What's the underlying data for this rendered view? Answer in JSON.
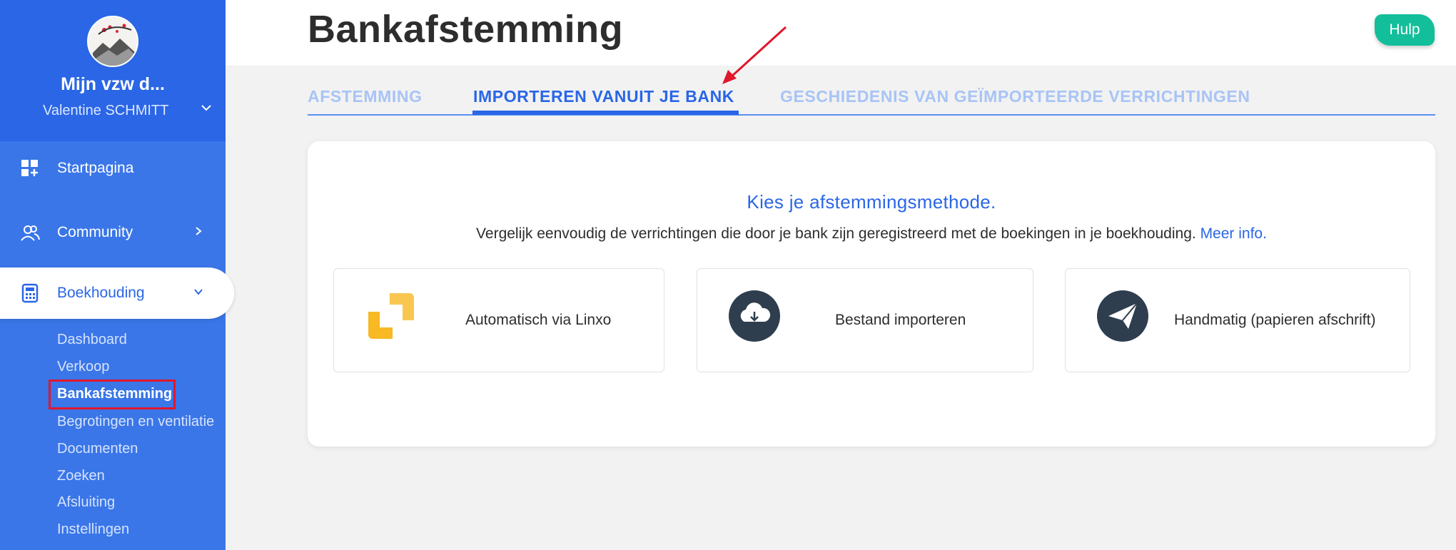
{
  "sidebar": {
    "org_name": "Mijn vzw d...",
    "user_name": "Valentine SCHMITT",
    "nav": {
      "start": "Startpagina",
      "community": "Community",
      "accounting": "Boekhouding"
    },
    "sub_items": [
      "Dashboard",
      "Verkoop",
      "Bankafstemming",
      "Begrotingen en ventilatie",
      "Documenten",
      "Zoeken",
      "Afsluiting",
      "Instellingen"
    ]
  },
  "header": {
    "title": "Bankafstemming",
    "help_label": "Hulp"
  },
  "tabs": [
    "AFSTEMMING",
    "IMPORTEREN VANUIT JE BANK",
    "GESCHIEDENIS VAN GEÏMPORTEERDE VERRICHTINGEN"
  ],
  "card": {
    "title": "Kies je afstemmingsmethode.",
    "description": "Vergelijk eenvoudig de verrichtingen die door je bank zijn geregistreerd met de boekingen in je boekhouding.",
    "more_info": "Meer info.",
    "options": [
      "Automatisch via Linxo",
      "Bestand importeren",
      "Handmatig (papieren afschrift)"
    ]
  },
  "colors": {
    "primary": "#2a66e6",
    "sidebar": "#3a76e8",
    "help": "#12bf9a",
    "linxo": "#f7b924",
    "highlight": "#e0172c"
  }
}
